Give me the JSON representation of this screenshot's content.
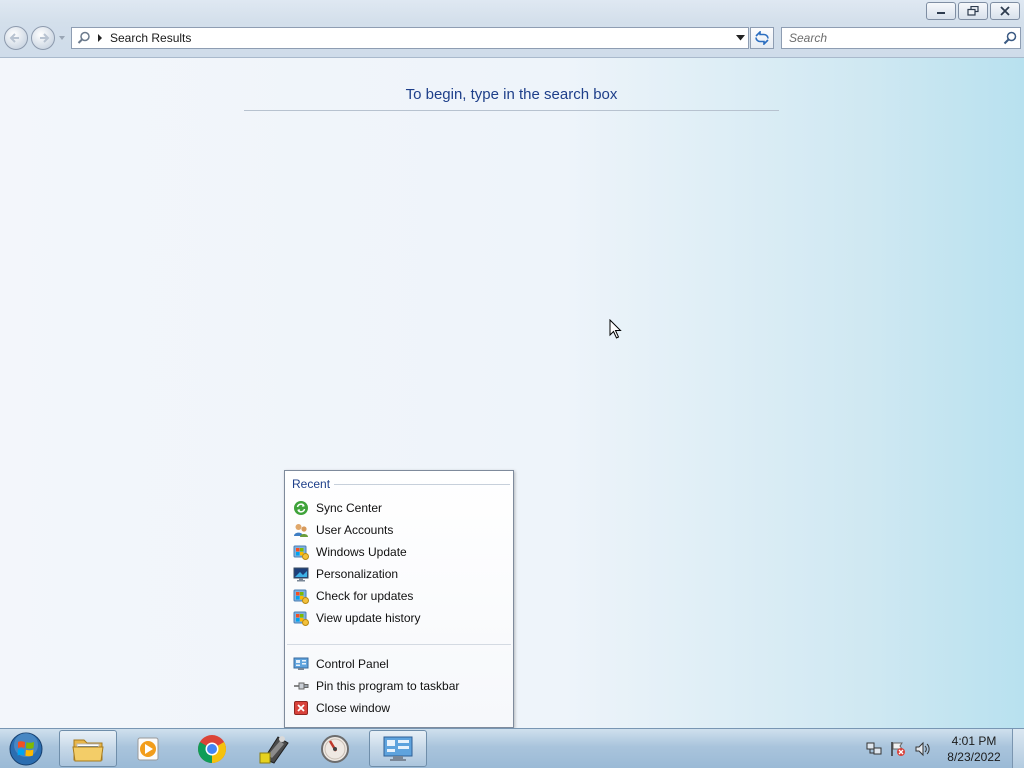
{
  "window": {
    "address_path": "Search Results",
    "search_placeholder": "Search",
    "content_message": "To begin, type in the search box"
  },
  "jumplist": {
    "recent_header": "Recent",
    "recent_items": [
      {
        "label": "Sync Center",
        "icon": "sync-center-icon"
      },
      {
        "label": "User Accounts",
        "icon": "user-accounts-icon"
      },
      {
        "label": "Windows Update",
        "icon": "windows-update-icon"
      },
      {
        "label": "Personalization",
        "icon": "personalization-icon"
      },
      {
        "label": "Check for updates",
        "icon": "windows-update-icon"
      },
      {
        "label": "View update history",
        "icon": "windows-update-icon"
      }
    ],
    "tasks": [
      {
        "label": "Control Panel",
        "icon": "control-panel-icon"
      },
      {
        "label": "Pin this program to taskbar",
        "icon": "pin-icon"
      },
      {
        "label": "Close window",
        "icon": "close-window-icon"
      }
    ]
  },
  "taskbar": {
    "apps": [
      {
        "name": "Windows Explorer",
        "icon": "folder-icon"
      },
      {
        "name": "Windows Media Player",
        "icon": "media-player-icon"
      },
      {
        "name": "Google Chrome",
        "icon": "chrome-icon"
      },
      {
        "name": "Film app",
        "icon": "film-icon"
      },
      {
        "name": "Clock app",
        "icon": "gauge-icon"
      },
      {
        "name": "Control Panel",
        "icon": "control-panel-icon"
      }
    ],
    "clock_time": "4:01 PM",
    "clock_date": "8/23/2022"
  },
  "colors": {
    "heading_blue": "#1e3f8a",
    "taskbar": "#a9c4dc"
  }
}
